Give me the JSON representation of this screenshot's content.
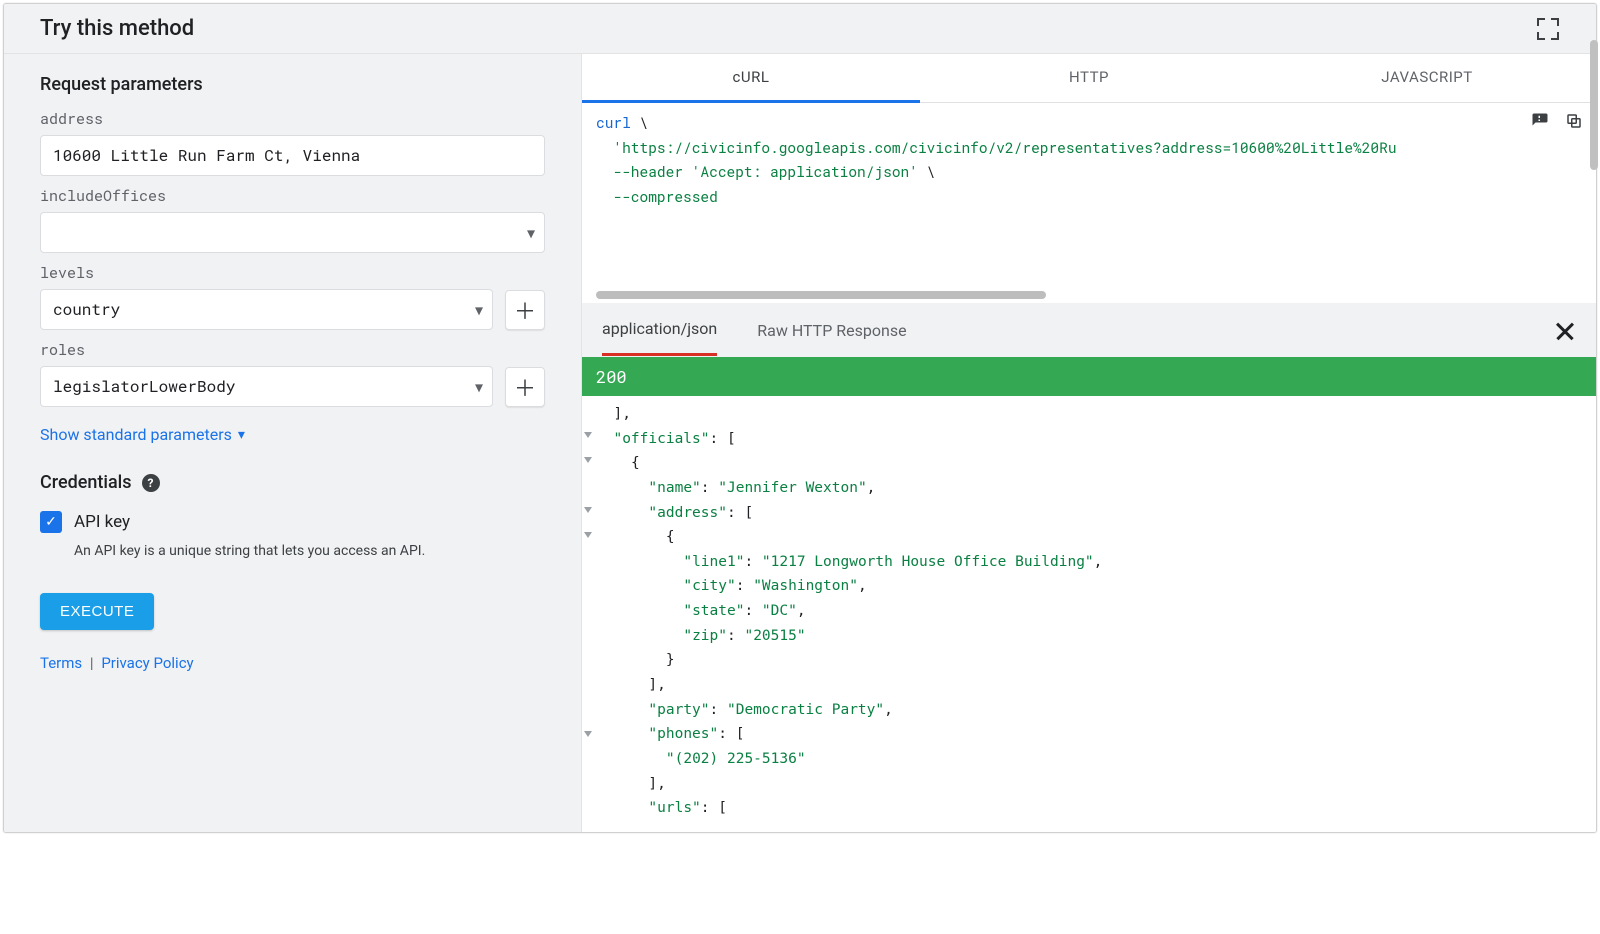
{
  "header": {
    "title": "Try this method"
  },
  "params": {
    "section_title": "Request parameters",
    "address_label": "address",
    "address_value": "10600 Little Run Farm Ct, Vienna",
    "includeOffices_label": "includeOffices",
    "includeOffices_value": "",
    "levels_label": "levels",
    "levels_value": "country",
    "roles_label": "roles",
    "roles_value": "legislatorLowerBody",
    "show_standard": "Show standard parameters"
  },
  "credentials": {
    "title": "Credentials",
    "apikey_label": "API key",
    "apikey_desc": "An API key is a unique string that lets you access an API."
  },
  "execute_label": "EXECUTE",
  "legal": {
    "terms": "Terms",
    "privacy": "Privacy Policy"
  },
  "request_tabs": {
    "curl": "cURL",
    "http": "HTTP",
    "js": "JAVASCRIPT"
  },
  "request_code": {
    "l1a": "curl",
    "l1b": " \\",
    "l2": "  'https://civicinfo.googleapis.com/civicinfo/v2/representatives?address=10600%20Little%20Ru",
    "l3a": "  --header ",
    "l3b": "'Accept: application/json'",
    "l3c": " \\",
    "l4": "  --compressed"
  },
  "response_tabs": {
    "json": "application/json",
    "raw": "Raw HTTP Response"
  },
  "status_code": "200",
  "response_json": {
    "lines": [
      "  ],",
      "  \"officials\": [",
      "    {",
      "      \"name\": \"Jennifer Wexton\",",
      "      \"address\": [",
      "        {",
      "          \"line1\": \"1217 Longworth House Office Building\",",
      "          \"city\": \"Washington\",",
      "          \"state\": \"DC\",",
      "          \"zip\": \"20515\"",
      "        }",
      "      ],",
      "      \"party\": \"Democratic Party\",",
      "      \"phones\": [",
      "        \"(202) 225-5136\"",
      "      ],",
      "      \"urls\": ["
    ]
  }
}
